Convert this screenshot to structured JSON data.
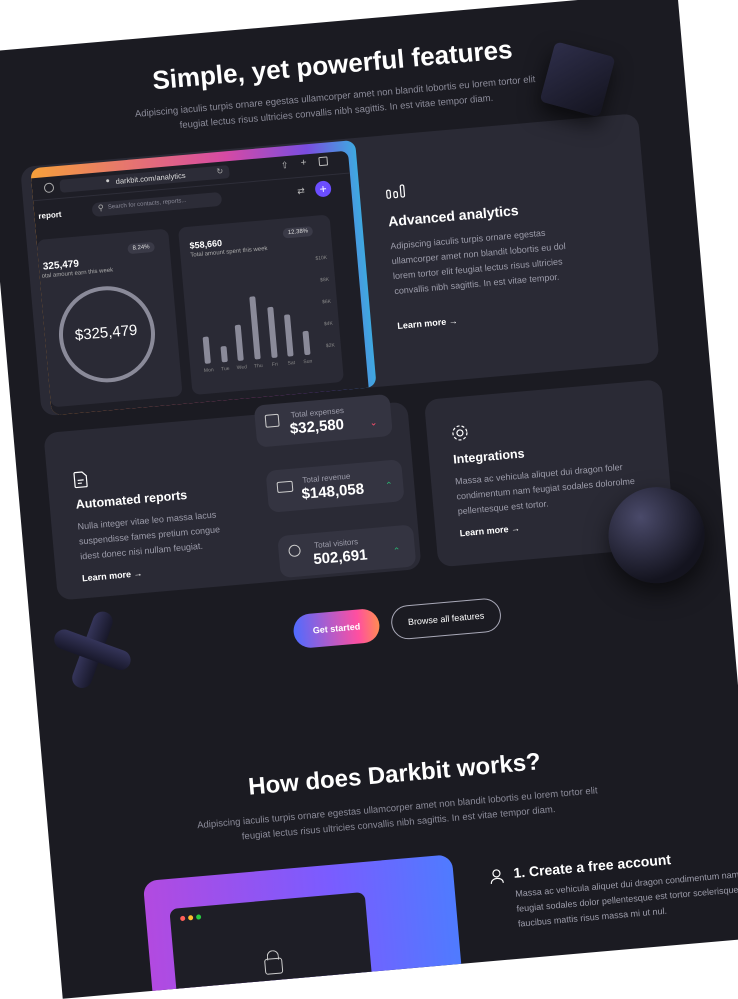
{
  "features": {
    "title": "Simple, yet powerful features",
    "subtitle_line1": "Adipiscing iaculis turpis ornare egestas ullamcorper amet non blandit lobortis eu lorem tortor elit",
    "subtitle_line2": "feugiat lectus risus ultricies convallis nibh sagittis. In est vitae tempor diam."
  },
  "mockup": {
    "url": "darkbit.com/analytics",
    "page_label": "report",
    "search_placeholder": "Search for contacts, reports...",
    "card1": {
      "value": "325,479",
      "label": "otal amount earn this week",
      "badge": "8.24%",
      "ring_value": "$325,479"
    },
    "card2": {
      "value": "$58,660",
      "label": "Total amount spent this week",
      "badge": "12.38%",
      "y_ticks": [
        "$10K",
        "$8K",
        "$6K",
        "$4K",
        "$2K"
      ],
      "days": [
        "Mon",
        "Tue",
        "Wed",
        "Thu",
        "Fri",
        "Sat",
        "Sun"
      ]
    }
  },
  "chart_data": {
    "type": "bar",
    "categories": [
      "Mon",
      "Tue",
      "Wed",
      "Thu",
      "Fri",
      "Sat",
      "Sun"
    ],
    "values": [
      2.8,
      1.6,
      3.7,
      6.4,
      5.2,
      4.3,
      2.4
    ],
    "ylabel": "",
    "ylim": [
      0,
      10
    ]
  },
  "analytics": {
    "title": "Advanced analytics",
    "text_lines": [
      "Adipiscing iaculis turpis ornare egestas",
      "ullamcorper amet non blandit lobortis eu dol",
      "lorem tortor elit feugiat lectus risus ultricies",
      "convallis nibh sagittis. In est vitae tempor."
    ],
    "link": "Learn more"
  },
  "reports": {
    "title": "Automated reports",
    "text_lines": [
      "Nulla integer vitae leo massa lacus",
      "suspendisse fames pretium congue",
      "idest donec nisi nullam feugiat."
    ],
    "link": "Learn more"
  },
  "stats": [
    {
      "label": "Total expenses",
      "value": "$32,580"
    },
    {
      "label": "Total revenue",
      "value": "$148,058"
    },
    {
      "label": "Total visitors",
      "value": "502,691"
    }
  ],
  "integrations": {
    "title": "Integrations",
    "text_lines": [
      "Massa ac vehicula aliquet dui dragon foler",
      "condimentum nam feugiat sodales dolorolme",
      "pellentesque est tortor."
    ],
    "link": "Learn more"
  },
  "buttons": {
    "primary": "Get started",
    "secondary": "Browse all features"
  },
  "how": {
    "title": "How does Darkbit works?",
    "subtitle_line1": "Adipiscing iaculis turpis ornare egestas ullamcorper amet non blandit lobortis eu lorem tortor elit",
    "subtitle_line2": "feugiat lectus risus ultricies convallis nibh sagittis. In est vitae tempor diam."
  },
  "step1": {
    "title": "1. Create a free account",
    "text_lines": [
      "Massa ac vehicula aliquet dui dragon condimentum nam",
      "feugiat sodales dolor pellentesque est tortor scelerisque",
      "faucibus mattis risus massa mi ut nul."
    ]
  },
  "colors": {
    "background": "#1b1b22",
    "card": "#2a2a35",
    "accent": "#6b4dff",
    "up": "#2bb673",
    "down": "#ff4f6d"
  }
}
